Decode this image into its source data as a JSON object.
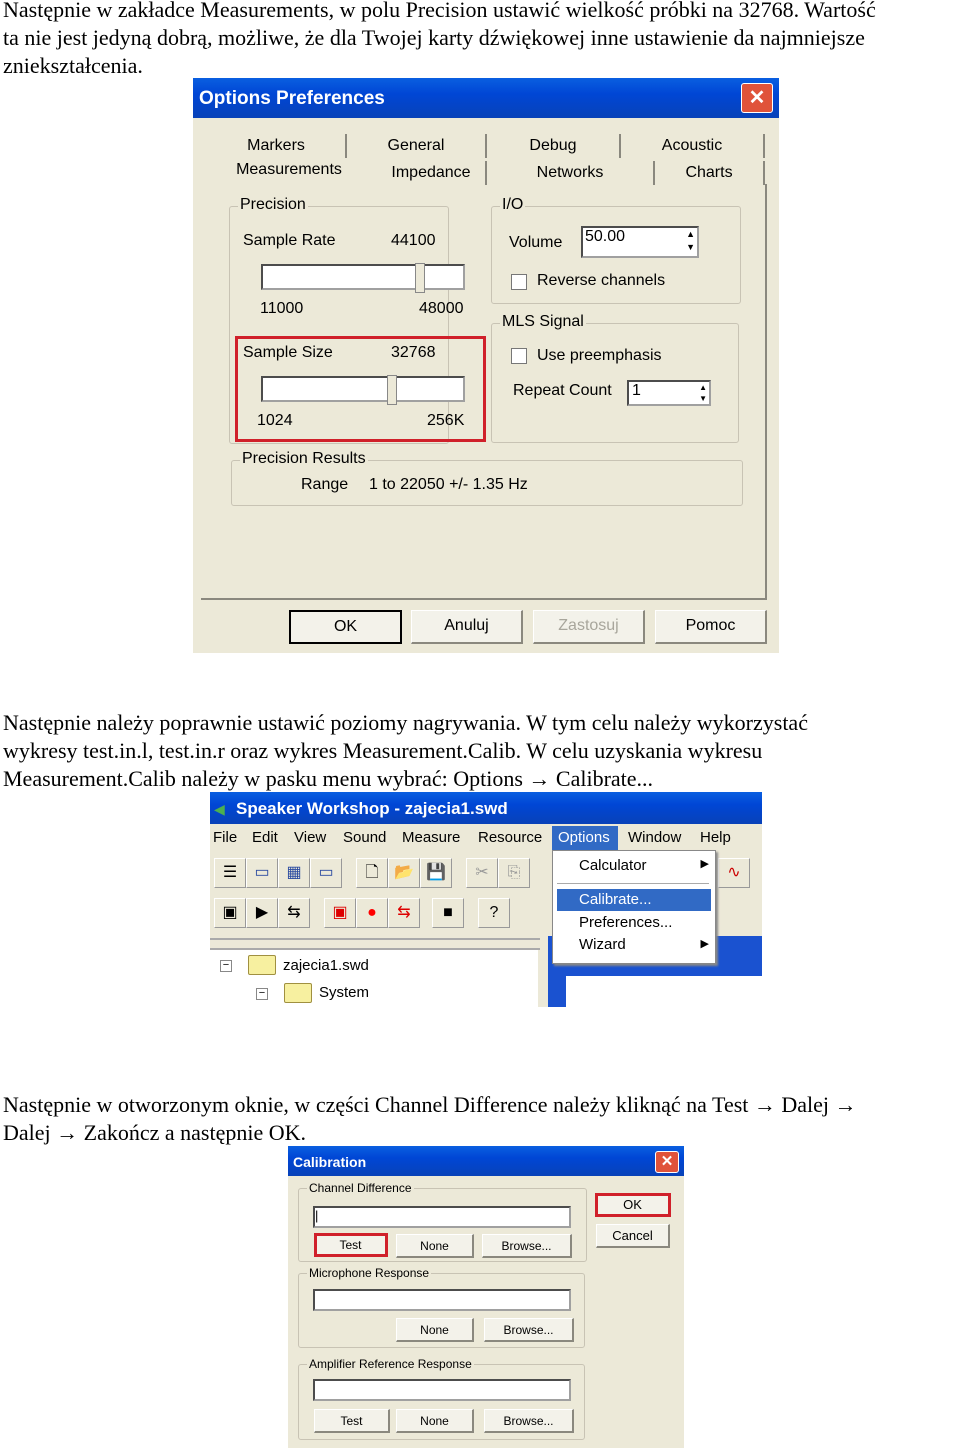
{
  "paragraphs": [
    [
      "Następnie w zakładce Measurements, w polu Precision ustawić wielkość próbki na 32768. Wartość",
      "ta nie jest jedyną dobrą, możliwe, że dla Twojej karty dźwiękowej inne ustawienie da najmniejsze",
      "zniekształcenia."
    ],
    [
      "Następnie należy poprawnie ustawić poziomy nagrywania. W tym celu należy wykorzystać",
      "wykresy test.in.l, test.in.r oraz wykres Measurement.Calib. W celu uzyskania wykresu",
      "Measurement.Calib należy w pasku menu wybrać: Options → Calibrate..."
    ],
    [
      "Następnie w otworzonym oknie, w części Channel Difference należy kliknąć na Test → Dalej →",
      "Dalej → Zakończ a następnie OK."
    ]
  ],
  "options_dialog": {
    "title": "Options Preferences",
    "tabs_row1": [
      "Markers",
      "General",
      "Debug",
      "Acoustic"
    ],
    "tabs_row2": [
      "Measurements",
      "Impedance",
      "Networks",
      "Charts"
    ],
    "active_tab": "Measurements",
    "precision": {
      "label": "Precision",
      "sample_rate_label": "Sample Rate",
      "sample_rate": "44100",
      "rate_min": "11000",
      "rate_max": "48000",
      "sample_size_label": "Sample Size",
      "sample_size": "32768",
      "size_min": "1024",
      "size_max": "256K"
    },
    "io": {
      "label": "I/O",
      "volume_label": "Volume",
      "volume": "50.00",
      "reverse_label": "Reverse channels",
      "reverse_checked": false
    },
    "mls": {
      "label": "MLS Signal",
      "preemphasis_label": "Use preemphasis",
      "preemphasis_checked": false,
      "repeat_label": "Repeat Count",
      "repeat": "1"
    },
    "results": {
      "label": "Precision Results",
      "range_label": "Range",
      "range_value": "1 to 22050 +/- 1.35 Hz"
    },
    "buttons": [
      "OK",
      "Anuluj",
      "Zastosuj",
      "Pomoc"
    ],
    "highlight_color": "#d0202a"
  },
  "sw_window": {
    "title": "Speaker Workshop - zajecia1.swd",
    "menu": [
      "File",
      "Edit",
      "View",
      "Sound",
      "Measure",
      "Resource",
      "Options",
      "Window",
      "Help"
    ],
    "active_menu": "Options",
    "dropdown": [
      "Calculator",
      "Calibrate...",
      "Preferences...",
      "Wizard"
    ],
    "selected_item": "Calibrate...",
    "tree": [
      "zajecia1.swd",
      "System"
    ]
  },
  "calibration": {
    "title": "Calibration",
    "channel_label": "Channel Difference",
    "mic_label": "Microphone Response",
    "amp_label": "Amplifier Reference Response",
    "test": "Test",
    "none": "None",
    "browse": "Browse...",
    "ok": "OK",
    "cancel": "Cancel"
  }
}
